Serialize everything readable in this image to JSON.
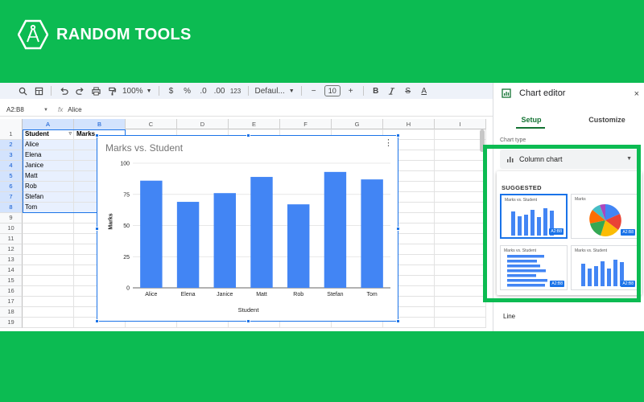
{
  "brand": {
    "name": "RANDOM TOOLS"
  },
  "toolbar": {
    "zoom": "100%",
    "currency": "$",
    "percent": "%",
    "dec_decrease": ".0",
    "dec_increase": ".00",
    "number_format": "123",
    "font": "Defaul...",
    "font_size": "10",
    "minus": "−",
    "plus": "+",
    "bold": "B",
    "strike": "S",
    "text_color": "A"
  },
  "formula_bar": {
    "name_box": "A2:B8",
    "fx": "fx",
    "value": "Alice"
  },
  "grid": {
    "columns": [
      "A",
      "B",
      "C",
      "D",
      "E",
      "F",
      "G",
      "H",
      "I"
    ],
    "rows": [
      "1",
      "2",
      "3",
      "4",
      "5",
      "6",
      "7",
      "8",
      "9",
      "10",
      "11",
      "12",
      "13",
      "14",
      "15",
      "16",
      "17",
      "18",
      "19"
    ],
    "header": [
      "Student",
      "Marks"
    ],
    "students": [
      "Alice",
      "Elena",
      "Janice",
      "Matt",
      "Rob",
      "Stefan",
      "Tom"
    ]
  },
  "chart_data": {
    "type": "bar",
    "title": "Marks vs. Student",
    "xlabel": "Student",
    "ylabel": "Marks",
    "categories": [
      "Alice",
      "Elena",
      "Janice",
      "Matt",
      "Rob",
      "Stefan",
      "Tom"
    ],
    "values": [
      86,
      69,
      76,
      89,
      67,
      93,
      87
    ],
    "yticks": [
      0,
      25,
      50,
      75,
      100
    ],
    "ylim": [
      0,
      100
    ],
    "grid": true,
    "color": "#4285f4"
  },
  "editor": {
    "title": "Chart editor",
    "close": "×",
    "tabs": [
      "Setup",
      "Customize"
    ],
    "chart_type_label": "Chart type",
    "chart_type_value": "Column chart",
    "suggested_label": "SUGGESTED",
    "thumb_titles": [
      "Marks vs. Student",
      "Marks",
      "Marks vs. Student",
      "Marks vs. Student"
    ],
    "thumb_badge": "A2:B8",
    "line_label": "Line"
  },
  "colors": {
    "brand_green": "#0cbb52",
    "accent_blue": "#1a73e8",
    "bar_blue": "#4285f4",
    "tab_green": "#137333"
  }
}
